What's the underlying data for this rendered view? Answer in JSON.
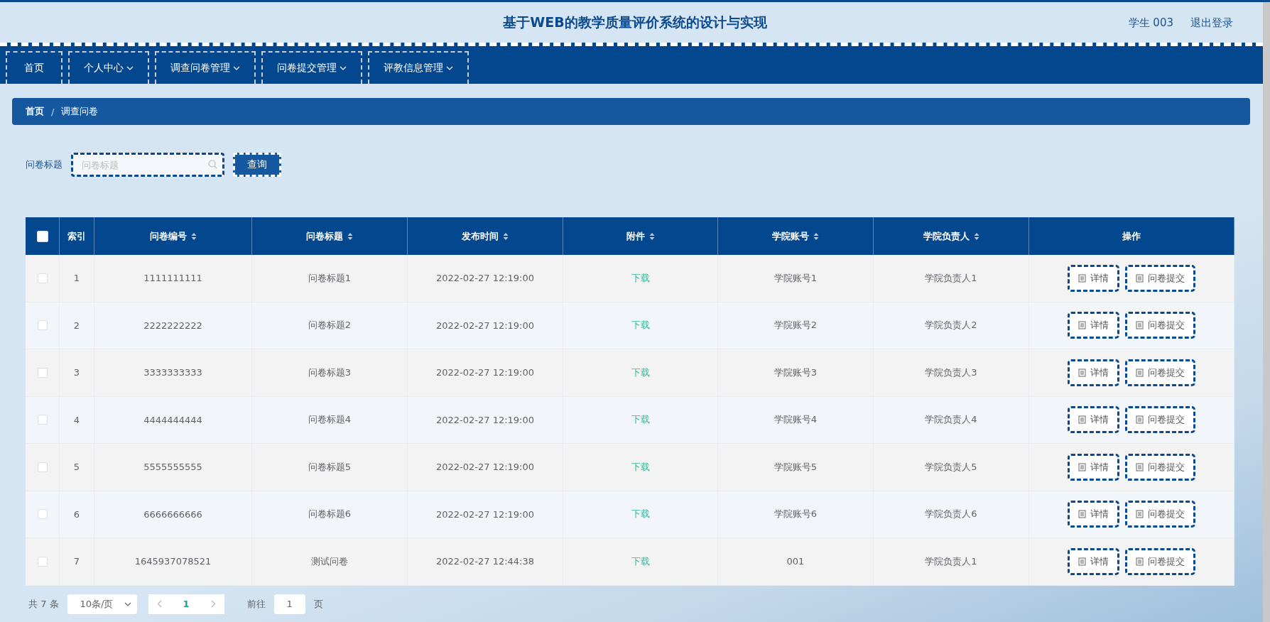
{
  "header": {
    "title": "基于WEB的教学质量评价系统的设计与实现",
    "user": "学生 003",
    "logout": "退出登录"
  },
  "nav": [
    {
      "label": "首页",
      "dropdown": false
    },
    {
      "label": "个人中心",
      "dropdown": true
    },
    {
      "label": "调查问卷管理",
      "dropdown": true
    },
    {
      "label": "问卷提交管理",
      "dropdown": true
    },
    {
      "label": "评教信息管理",
      "dropdown": true
    }
  ],
  "breadcrumb": {
    "items": [
      "首页",
      "调查问卷"
    ],
    "separator": "/"
  },
  "search": {
    "label": "问卷标题",
    "placeholder": "问卷标题",
    "button": "查询"
  },
  "table": {
    "select_all": {
      "checked": false
    },
    "columns": [
      {
        "label": "索引",
        "sortable": false
      },
      {
        "label": "问卷编号",
        "sortable": true
      },
      {
        "label": "问卷标题",
        "sortable": true
      },
      {
        "label": "发布时间",
        "sortable": true
      },
      {
        "label": "附件",
        "sortable": true
      },
      {
        "label": "学院账号",
        "sortable": true
      },
      {
        "label": "学院负责人",
        "sortable": true
      },
      {
        "label": "操作",
        "sortable": false
      }
    ],
    "rows": [
      {
        "checked": false,
        "cells": [
          "1",
          "1111111111",
          "问卷标题1",
          "2022-02-27 12:19:00",
          "下载",
          "学院账号1",
          "学院负责人1"
        ],
        "actions": [
          "详情",
          "问卷提交"
        ]
      },
      {
        "checked": false,
        "cells": [
          "2",
          "2222222222",
          "问卷标题2",
          "2022-02-27 12:19:00",
          "下载",
          "学院账号2",
          "学院负责人2"
        ],
        "actions": [
          "详情",
          "问卷提交"
        ]
      },
      {
        "checked": false,
        "cells": [
          "3",
          "3333333333",
          "问卷标题3",
          "2022-02-27 12:19:00",
          "下载",
          "学院账号3",
          "学院负责人3"
        ],
        "actions": [
          "详情",
          "问卷提交"
        ]
      },
      {
        "checked": false,
        "cells": [
          "4",
          "4444444444",
          "问卷标题4",
          "2022-02-27 12:19:00",
          "下载",
          "学院账号4",
          "学院负责人4"
        ],
        "actions": [
          "详情",
          "问卷提交"
        ]
      },
      {
        "checked": false,
        "cells": [
          "5",
          "5555555555",
          "问卷标题5",
          "2022-02-27 12:19:00",
          "下载",
          "学院账号5",
          "学院负责人5"
        ],
        "actions": [
          "详情",
          "问卷提交"
        ]
      },
      {
        "checked": false,
        "cells": [
          "6",
          "6666666666",
          "问卷标题6",
          "2022-02-27 12:19:00",
          "下载",
          "学院账号6",
          "学院负责人6"
        ],
        "actions": [
          "详情",
          "问卷提交"
        ]
      },
      {
        "checked": false,
        "cells": [
          "7",
          "1645937078521",
          "测试问卷",
          "2022-02-27 12:44:38",
          "下载",
          "001",
          "学院负责人1"
        ],
        "actions": [
          "详情",
          "问卷提交"
        ]
      }
    ]
  },
  "pagination": {
    "total": "共 7 条",
    "page_size": "10条/页",
    "pages": [
      {
        "label": "1",
        "selected": true
      }
    ],
    "goto_label": "前往",
    "goto_value": "1",
    "goto_suffix": "页"
  }
}
